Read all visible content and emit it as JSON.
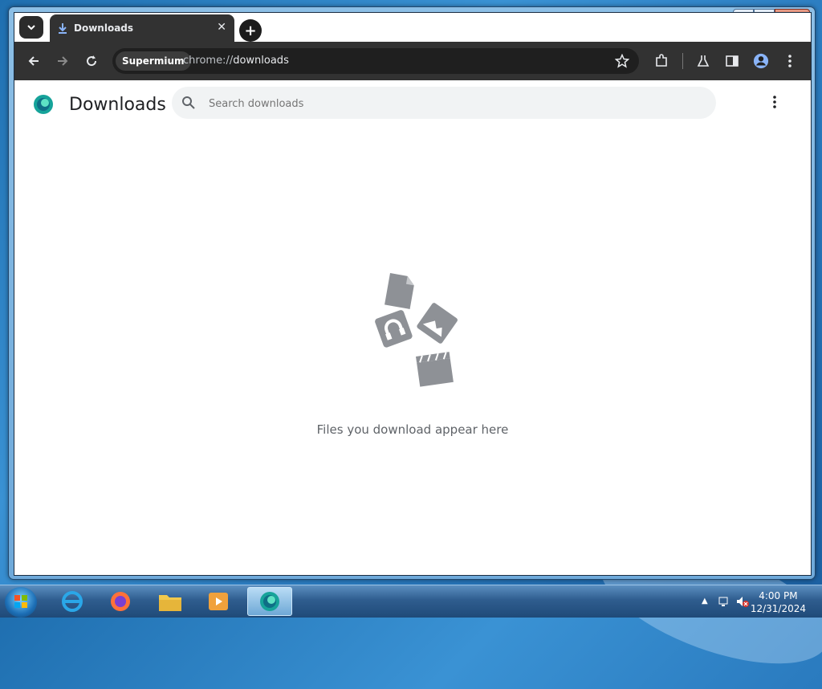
{
  "window": {
    "min": "▁",
    "max": "□",
    "close": "✕"
  },
  "tab": {
    "title": "Downloads",
    "close": "✕"
  },
  "newtab": {
    "label": "+"
  },
  "toolbar": {
    "chip": "Supermium",
    "url_prefix": "chrome://",
    "url_path": "downloads"
  },
  "page": {
    "title": "Downloads",
    "search_placeholder": "Search downloads",
    "empty_message": "Files you download appear here"
  },
  "taskbar": {
    "time": "4:00 PM",
    "date": "12/31/2024"
  },
  "colors": {
    "toolbar": "#323232",
    "omnibox": "#1f1f1f",
    "accent": "#1a73e8",
    "empty_icon": "#8e9196"
  }
}
